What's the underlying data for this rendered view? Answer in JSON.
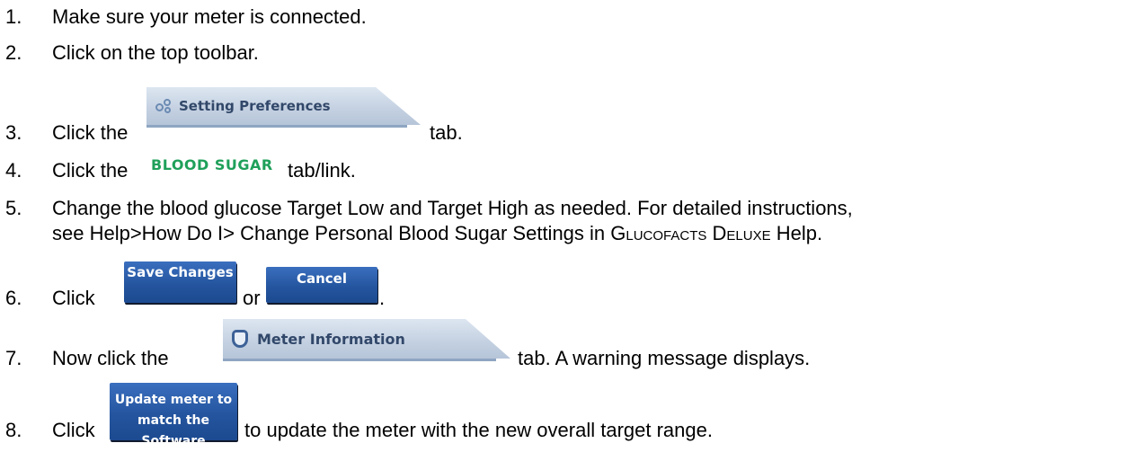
{
  "steps": [
    {
      "num": "1.",
      "text": "Make sure your meter is connected."
    },
    {
      "num": "2.",
      "text": "Click on the top toolbar."
    },
    {
      "num": "3.",
      "pre": "Click the",
      "tab_label": "Setting Preferences",
      "post": "tab."
    },
    {
      "num": "4.",
      "pre": "Click the",
      "link_label": "BLOOD SUGAR",
      "post": "tab/link."
    },
    {
      "num": "5.",
      "line1": "Change the blood glucose Target Low and Target High as needed. For detailed instructions,",
      "line2_a": "see Help>How Do I> Change Personal Blood Sugar Settings in ",
      "line2_product": "Glucofacts Deluxe",
      "line2_b": " Help."
    },
    {
      "num": "6.",
      "pre": "Click",
      "button1": "Save Changes",
      "mid": "or",
      "button2": "Cancel",
      "post": "."
    },
    {
      "num": "7.",
      "pre": "Now click the",
      "tab_label": "Meter Information",
      "post": "tab.  A warning message displays."
    },
    {
      "num": "8.",
      "pre": "Click",
      "button_line1": "Update meter to",
      "button_line2": "match the Software",
      "post": "to update the meter with the new overall target range."
    }
  ],
  "icons": {
    "setting_tab": "gear-icon",
    "meter_tab": "meter-icon"
  },
  "colors": {
    "tab_text": "#32486a",
    "link_green": "#1fa05a",
    "button_blue": "#25559f"
  }
}
